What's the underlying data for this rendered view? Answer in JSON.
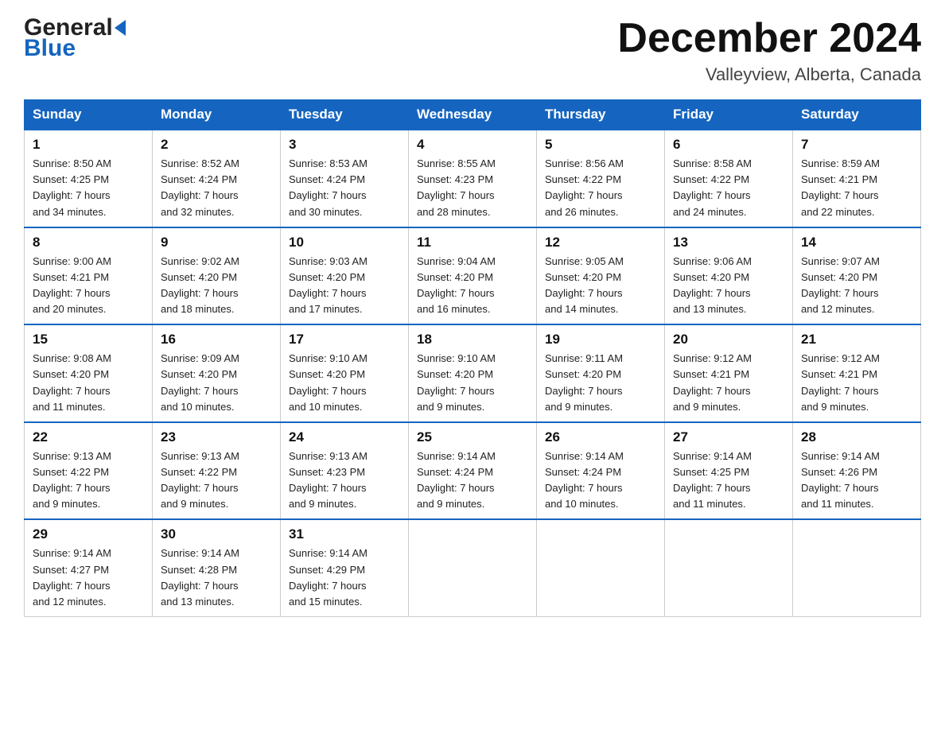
{
  "logo": {
    "general": "General",
    "arrow": "▶",
    "blue": "Blue"
  },
  "header": {
    "title": "December 2024",
    "subtitle": "Valleyview, Alberta, Canada"
  },
  "weekdays": [
    "Sunday",
    "Monday",
    "Tuesday",
    "Wednesday",
    "Thursday",
    "Friday",
    "Saturday"
  ],
  "weeks": [
    [
      {
        "day": "1",
        "info": "Sunrise: 8:50 AM\nSunset: 4:25 PM\nDaylight: 7 hours\nand 34 minutes."
      },
      {
        "day": "2",
        "info": "Sunrise: 8:52 AM\nSunset: 4:24 PM\nDaylight: 7 hours\nand 32 minutes."
      },
      {
        "day": "3",
        "info": "Sunrise: 8:53 AM\nSunset: 4:24 PM\nDaylight: 7 hours\nand 30 minutes."
      },
      {
        "day": "4",
        "info": "Sunrise: 8:55 AM\nSunset: 4:23 PM\nDaylight: 7 hours\nand 28 minutes."
      },
      {
        "day": "5",
        "info": "Sunrise: 8:56 AM\nSunset: 4:22 PM\nDaylight: 7 hours\nand 26 minutes."
      },
      {
        "day": "6",
        "info": "Sunrise: 8:58 AM\nSunset: 4:22 PM\nDaylight: 7 hours\nand 24 minutes."
      },
      {
        "day": "7",
        "info": "Sunrise: 8:59 AM\nSunset: 4:21 PM\nDaylight: 7 hours\nand 22 minutes."
      }
    ],
    [
      {
        "day": "8",
        "info": "Sunrise: 9:00 AM\nSunset: 4:21 PM\nDaylight: 7 hours\nand 20 minutes."
      },
      {
        "day": "9",
        "info": "Sunrise: 9:02 AM\nSunset: 4:20 PM\nDaylight: 7 hours\nand 18 minutes."
      },
      {
        "day": "10",
        "info": "Sunrise: 9:03 AM\nSunset: 4:20 PM\nDaylight: 7 hours\nand 17 minutes."
      },
      {
        "day": "11",
        "info": "Sunrise: 9:04 AM\nSunset: 4:20 PM\nDaylight: 7 hours\nand 16 minutes."
      },
      {
        "day": "12",
        "info": "Sunrise: 9:05 AM\nSunset: 4:20 PM\nDaylight: 7 hours\nand 14 minutes."
      },
      {
        "day": "13",
        "info": "Sunrise: 9:06 AM\nSunset: 4:20 PM\nDaylight: 7 hours\nand 13 minutes."
      },
      {
        "day": "14",
        "info": "Sunrise: 9:07 AM\nSunset: 4:20 PM\nDaylight: 7 hours\nand 12 minutes."
      }
    ],
    [
      {
        "day": "15",
        "info": "Sunrise: 9:08 AM\nSunset: 4:20 PM\nDaylight: 7 hours\nand 11 minutes."
      },
      {
        "day": "16",
        "info": "Sunrise: 9:09 AM\nSunset: 4:20 PM\nDaylight: 7 hours\nand 10 minutes."
      },
      {
        "day": "17",
        "info": "Sunrise: 9:10 AM\nSunset: 4:20 PM\nDaylight: 7 hours\nand 10 minutes."
      },
      {
        "day": "18",
        "info": "Sunrise: 9:10 AM\nSunset: 4:20 PM\nDaylight: 7 hours\nand 9 minutes."
      },
      {
        "day": "19",
        "info": "Sunrise: 9:11 AM\nSunset: 4:20 PM\nDaylight: 7 hours\nand 9 minutes."
      },
      {
        "day": "20",
        "info": "Sunrise: 9:12 AM\nSunset: 4:21 PM\nDaylight: 7 hours\nand 9 minutes."
      },
      {
        "day": "21",
        "info": "Sunrise: 9:12 AM\nSunset: 4:21 PM\nDaylight: 7 hours\nand 9 minutes."
      }
    ],
    [
      {
        "day": "22",
        "info": "Sunrise: 9:13 AM\nSunset: 4:22 PM\nDaylight: 7 hours\nand 9 minutes."
      },
      {
        "day": "23",
        "info": "Sunrise: 9:13 AM\nSunset: 4:22 PM\nDaylight: 7 hours\nand 9 minutes."
      },
      {
        "day": "24",
        "info": "Sunrise: 9:13 AM\nSunset: 4:23 PM\nDaylight: 7 hours\nand 9 minutes."
      },
      {
        "day": "25",
        "info": "Sunrise: 9:14 AM\nSunset: 4:24 PM\nDaylight: 7 hours\nand 9 minutes."
      },
      {
        "day": "26",
        "info": "Sunrise: 9:14 AM\nSunset: 4:24 PM\nDaylight: 7 hours\nand 10 minutes."
      },
      {
        "day": "27",
        "info": "Sunrise: 9:14 AM\nSunset: 4:25 PM\nDaylight: 7 hours\nand 11 minutes."
      },
      {
        "day": "28",
        "info": "Sunrise: 9:14 AM\nSunset: 4:26 PM\nDaylight: 7 hours\nand 11 minutes."
      }
    ],
    [
      {
        "day": "29",
        "info": "Sunrise: 9:14 AM\nSunset: 4:27 PM\nDaylight: 7 hours\nand 12 minutes."
      },
      {
        "day": "30",
        "info": "Sunrise: 9:14 AM\nSunset: 4:28 PM\nDaylight: 7 hours\nand 13 minutes."
      },
      {
        "day": "31",
        "info": "Sunrise: 9:14 AM\nSunset: 4:29 PM\nDaylight: 7 hours\nand 15 minutes."
      },
      {
        "day": "",
        "info": ""
      },
      {
        "day": "",
        "info": ""
      },
      {
        "day": "",
        "info": ""
      },
      {
        "day": "",
        "info": ""
      }
    ]
  ]
}
